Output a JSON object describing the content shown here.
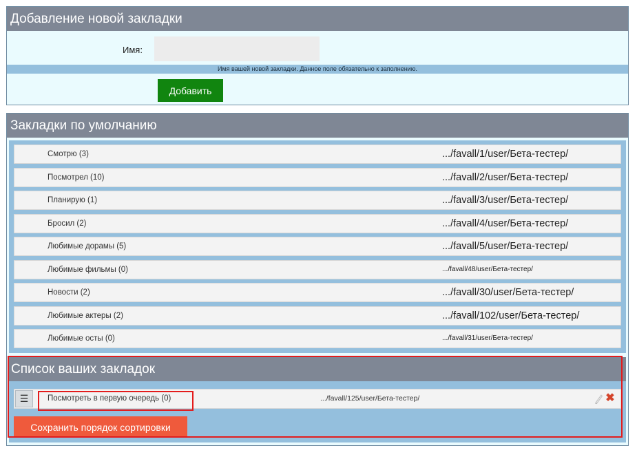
{
  "add_panel": {
    "title": "Добавление новой закладки",
    "name_label": "Имя:",
    "name_value": "",
    "name_placeholder": "",
    "hint": "Имя вашей новой закладки. Данное поле обязательно к заполнению.",
    "add_button": "Добавить"
  },
  "default_panel": {
    "title": "Закладки по умолчанию",
    "items": [
      {
        "label": "Смотрю (3)",
        "url": ".../favall/1/user/Бета-тестер/"
      },
      {
        "label": "Посмотрел (10)",
        "url": ".../favall/2/user/Бета-тестер/"
      },
      {
        "label": "Планирую (1)",
        "url": ".../favall/3/user/Бета-тестер/"
      },
      {
        "label": "Бросил (2)",
        "url": ".../favall/4/user/Бета-тестер/"
      },
      {
        "label": "Любимые дорамы (5)",
        "url": ".../favall/5/user/Бета-тестер/"
      },
      {
        "label": "Любимые фильмы (0)",
        "url": ".../favall/48/user/Бета-тестер/"
      },
      {
        "label": "Новости (2)",
        "url": ".../favall/30/user/Бета-тестер/"
      },
      {
        "label": "Любимые актеры (2)",
        "url": ".../favall/102/user/Бета-тестер/"
      },
      {
        "label": "Любимые осты (0)",
        "url": ".../favall/31/user/Бета-тестер/"
      }
    ]
  },
  "user_panel": {
    "title": "Список ваших закладок",
    "handle_icon": "☰",
    "items": [
      {
        "label": "Посмотреть в первую очередь (0)",
        "url": ".../favall/125/user/Бета-тестер/"
      }
    ],
    "save_button": "Сохранить порядок сортировки"
  },
  "colors": {
    "header_bg": "#7f8795",
    "panel_bg": "#eafbfe",
    "list_bg": "#94bfdd",
    "add_button": "#11850f",
    "save_button": "#ef5a3c",
    "highlight": "#e31c1c"
  }
}
